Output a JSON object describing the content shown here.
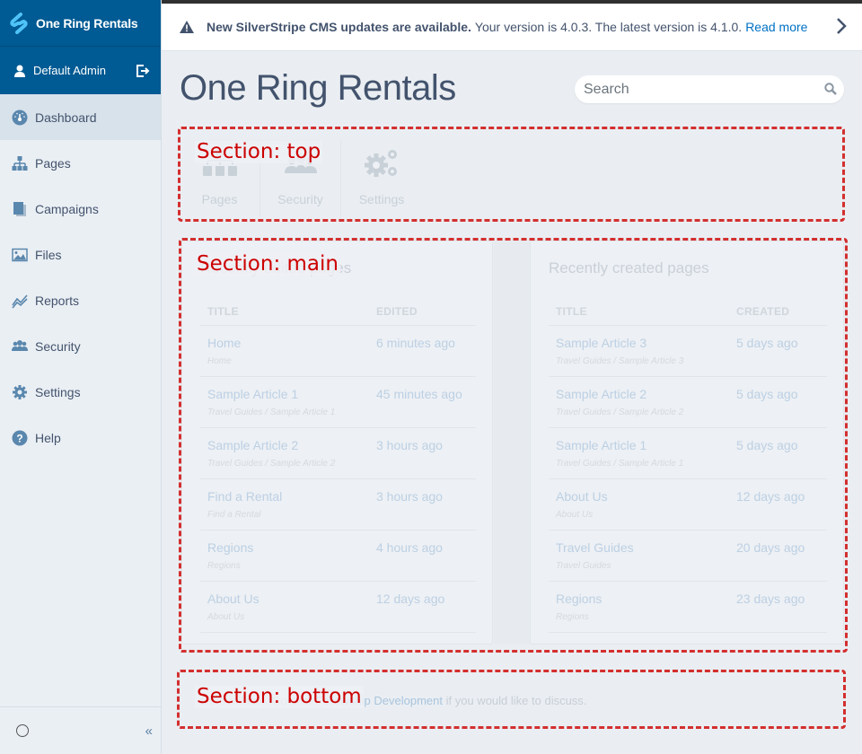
{
  "sidebar": {
    "brand": "One Ring Rentals",
    "user": "Default Admin",
    "items": [
      {
        "label": "Dashboard",
        "icon": "dashboard-icon",
        "active": true
      },
      {
        "label": "Pages",
        "icon": "sitemap-icon"
      },
      {
        "label": "Campaigns",
        "icon": "campaigns-icon"
      },
      {
        "label": "Files",
        "icon": "image-icon"
      },
      {
        "label": "Reports",
        "icon": "chart-line-icon"
      },
      {
        "label": "Security",
        "icon": "users-icon"
      },
      {
        "label": "Settings",
        "icon": "gear-icon"
      },
      {
        "label": "Help",
        "icon": "help-icon"
      }
    ],
    "collapse_glyph": "«"
  },
  "notice": {
    "bold": "New SilverStripe CMS updates are available.",
    "text": "Your version is 4.0.3. The latest version is 4.1.0.",
    "link": "Read more"
  },
  "header": {
    "title": "One Ring Rentals",
    "search_placeholder": "Search"
  },
  "shortcuts": [
    {
      "label": "Pages",
      "icon": "pages-icon"
    },
    {
      "label": "Security",
      "icon": "security-icon"
    },
    {
      "label": "Settings",
      "icon": "settings-icon"
    }
  ],
  "edited": {
    "title": "Recently edited pages",
    "col_title": "TITLE",
    "col_date": "EDITED",
    "rows": [
      {
        "title": "Home",
        "path": "Home",
        "date": "6 minutes ago"
      },
      {
        "title": "Sample Article 1",
        "path": "Travel Guides / Sample Article 1",
        "date": "45 minutes ago"
      },
      {
        "title": "Sample Article 2",
        "path": "Travel Guides / Sample Article 2",
        "date": "3 hours ago"
      },
      {
        "title": "Find a Rental",
        "path": "Find a Rental",
        "date": "3 hours ago"
      },
      {
        "title": "Regions",
        "path": "Regions",
        "date": "4 hours ago"
      },
      {
        "title": "About Us",
        "path": "About Us",
        "date": "12 days ago"
      }
    ]
  },
  "created": {
    "title": "Recently created pages",
    "col_title": "TITLE",
    "col_date": "CREATED",
    "rows": [
      {
        "title": "Sample Article 3",
        "path": "Travel Guides / Sample Article 3",
        "date": "5 days ago"
      },
      {
        "title": "Sample Article 2",
        "path": "Travel Guides / Sample Article 2",
        "date": "5 days ago"
      },
      {
        "title": "Sample Article 1",
        "path": "Travel Guides / Sample Article 1",
        "date": "5 days ago"
      },
      {
        "title": "About Us",
        "path": "About Us",
        "date": "12 days ago"
      },
      {
        "title": "Travel Guides",
        "path": "Travel Guides",
        "date": "20 days ago"
      },
      {
        "title": "Regions",
        "path": "Regions",
        "date": "23 days ago"
      }
    ]
  },
  "bottom": {
    "text_before": "are available. Contact",
    "link": "Fellowship Development",
    "text_after": "if you would like to discuss."
  },
  "sections": {
    "top": "Section: top",
    "main": "Section: main",
    "bottom": "Section: bottom"
  },
  "colors": {
    "brand": "#005a93",
    "link": "#0071c4",
    "section_outline": "#d32f2f"
  }
}
